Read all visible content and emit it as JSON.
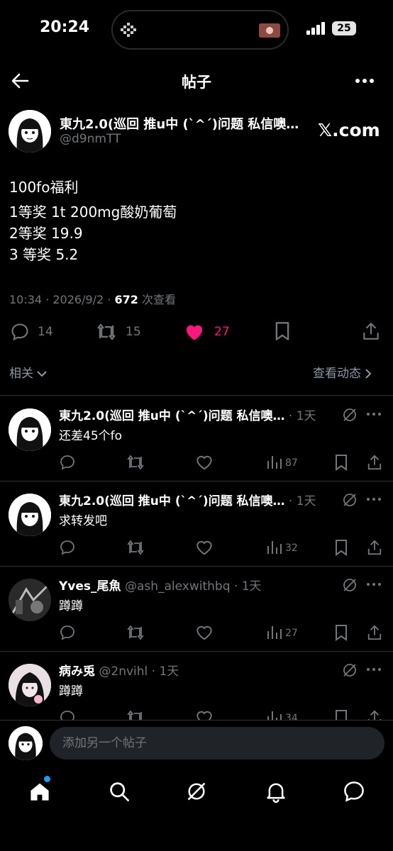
{
  "status_bar": {
    "time": "20:24",
    "battery": "25"
  },
  "header": {
    "title": "帖子"
  },
  "main_post": {
    "author_name": "東九2.0(巡回 推u中 (ˋ^ˊ)问题 私信噢m…",
    "handle": "@d9nmTT",
    "xcom": "𝕏.com",
    "lines": [
      "100fo福利",
      "1等奖 1t 200mg酸奶葡萄",
      "2等奖 19.9",
      "3 等奖 5.2"
    ],
    "meta_time": "10:34 · 2026/9/2 · ",
    "views_count": "672",
    "views_label": " 次查看",
    "replies": "14",
    "reposts": "15",
    "likes": "27",
    "related_label": "相关",
    "view_activity_label": "查看动态"
  },
  "replies": [
    {
      "name": "東九2.0(巡回 推u中 (ˋ^ˊ)问题 私信噢…",
      "sub": " · 1天",
      "text": "还差45个fo",
      "views": "87"
    },
    {
      "name": "東九2.0(巡回 推u中 (ˋ^ˊ)问题 私信噢…",
      "sub": " · 1天",
      "text": "求转发吧",
      "views": "32"
    },
    {
      "name": "Yves_尾魚",
      "sub": " @ash_alexwithbq · 1天",
      "text": "蹲蹲",
      "views": "27"
    },
    {
      "name": "病み兎",
      "sub": " @2nvihl · 1天",
      "text": "蹲蹲",
      "views": "34"
    }
  ],
  "compose": {
    "placeholder": "添加另一个帖子"
  },
  "colors": {
    "background": "#000000",
    "like_pink": "#f91880",
    "accent_blue": "#1d9bf0",
    "muted": "#71767b"
  },
  "icons": [
    "back-arrow-icon",
    "more-icon",
    "reply-icon",
    "repost-icon",
    "heart-icon",
    "bookmark-icon",
    "share-icon",
    "grok-icon",
    "views-icon",
    "home-icon",
    "search-icon",
    "bell-icon",
    "messages-icon"
  ]
}
